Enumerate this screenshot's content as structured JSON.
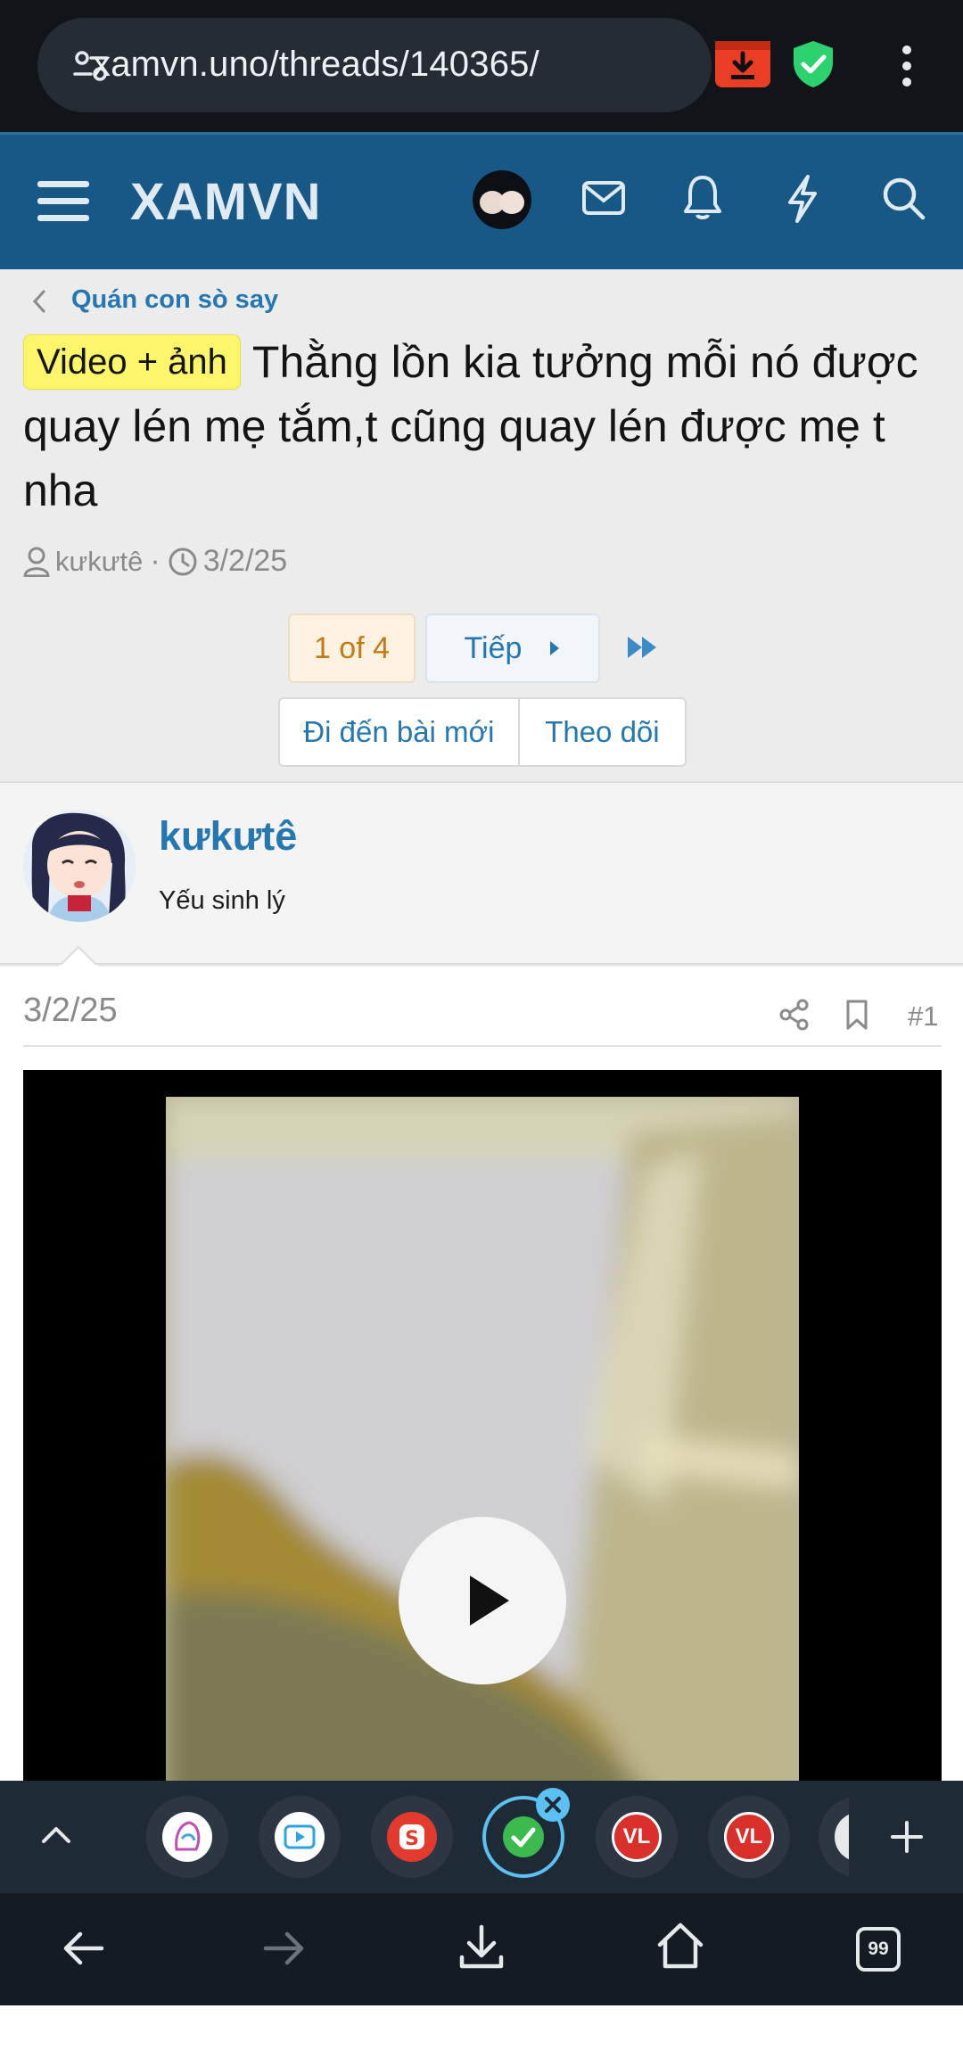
{
  "browser": {
    "url": "xamvn.uno/threads/140365/",
    "tab_count": "99"
  },
  "site": {
    "logo": "XAMVN"
  },
  "breadcrumb": {
    "label": "Quán con sò say"
  },
  "thread": {
    "prefix": "Video + ảnh",
    "title": "Thằng lồn kia tưởng mỗi nó được quay lén mẹ tắm,t cũng quay lén được mẹ t nha",
    "author": "kưkưtê",
    "date": "3/2/25"
  },
  "pagination": {
    "current": "1 of 4",
    "next_label": "Tiếp"
  },
  "actions": {
    "goto_new": "Đi đến bài mới",
    "watch": "Theo dõi"
  },
  "post": {
    "author": "kưkưtê",
    "user_title": "Yếu sinh lý",
    "date": "3/2/25",
    "number": "#1"
  },
  "tabs": {
    "vl1": "VL",
    "vl2": "VL"
  },
  "colors": {
    "header": "#185886",
    "link": "#2577b1",
    "prefix_bg": "#fdf56a",
    "page_current": "#c07a17"
  }
}
